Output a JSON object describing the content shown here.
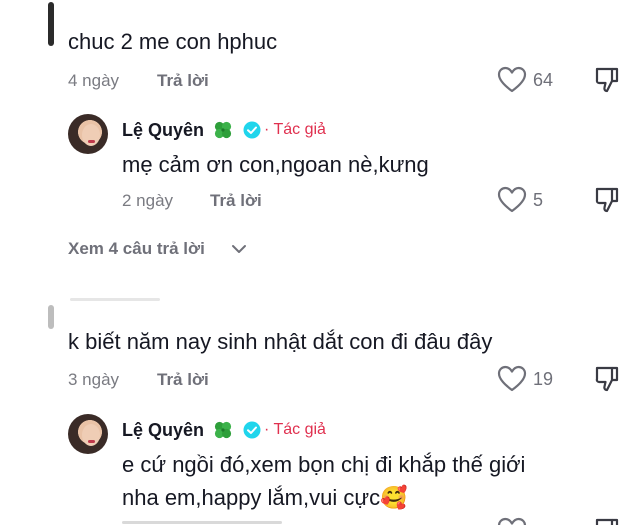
{
  "comments": [
    {
      "text": "chuc 2 me con hphuc",
      "time": "4 ngày",
      "reply_label": "Trả lời",
      "likes": "64",
      "replies": [
        {
          "author": "Lệ Quyên",
          "author_tag": "· Tác giả",
          "text": "mẹ cảm ơn con,ngoan nè,kưng",
          "time": "2 ngày",
          "reply_label": "Trả lời",
          "likes": "5"
        }
      ],
      "view_more": "Xem 4 câu trả lời"
    },
    {
      "text": "k biết năm nay sinh nhật dắt con đi đâu đây",
      "time": "3 ngày",
      "reply_label": "Trả lời",
      "likes": "19",
      "replies": [
        {
          "author": "Lệ Quyên",
          "author_tag": "· Tác giả",
          "text_line1": "e cứ ngồi đó,xem bọn chị đi khắp thế giới",
          "text_line2": "nha em,happy lắm,vui cực",
          "emoji": "🥰"
        }
      ]
    }
  ],
  "icons": {
    "like": "heart-outline-icon",
    "dislike": "thumbs-down-icon",
    "author_badge": "clover-icon",
    "verified": "verified-badge-icon",
    "expand": "chevron-down-icon"
  },
  "colors": {
    "author_tag": "#e0304f",
    "verified": "#20d5ec",
    "clover": "#2e9f3a",
    "muted": "#6f7079"
  }
}
